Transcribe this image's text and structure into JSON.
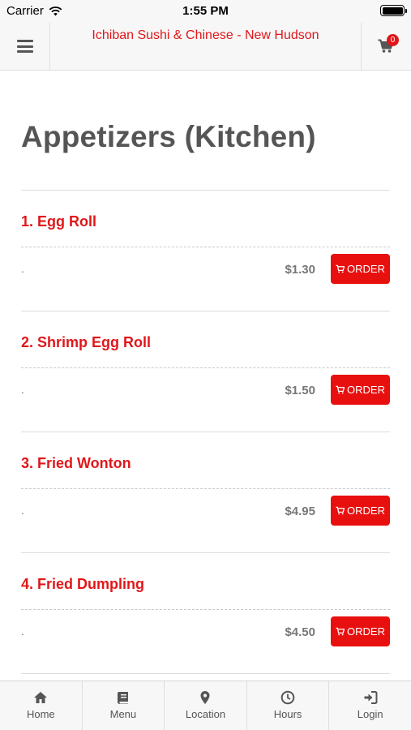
{
  "status_bar": {
    "carrier": "Carrier",
    "time": "1:55 PM"
  },
  "header": {
    "title": "Ichiban Sushi & Chinese - New Hudson",
    "cart_count": "0"
  },
  "page": {
    "title": "Appetizers (Kitchen)"
  },
  "items": [
    {
      "name": "1. Egg Roll",
      "description": ".",
      "price": "$1.30",
      "button": "ORDER"
    },
    {
      "name": "2. Shrimp Egg Roll",
      "description": ".",
      "price": "$1.50",
      "button": "ORDER"
    },
    {
      "name": "3. Fried Wonton",
      "description": ".",
      "price": "$4.95",
      "button": "ORDER"
    },
    {
      "name": "4. Fried Dumpling",
      "description": ".",
      "price": "$4.50",
      "button": "ORDER"
    }
  ],
  "tabs": [
    {
      "label": "Home",
      "icon": "home-icon"
    },
    {
      "label": "Menu",
      "icon": "book-icon"
    },
    {
      "label": "Location",
      "icon": "map-marker-icon"
    },
    {
      "label": "Hours",
      "icon": "clock-icon"
    },
    {
      "label": "Login",
      "icon": "sign-in-icon"
    }
  ],
  "colors": {
    "accent": "#e0171a",
    "button": "#e8100f",
    "bar_bg": "#f7f7f7"
  }
}
